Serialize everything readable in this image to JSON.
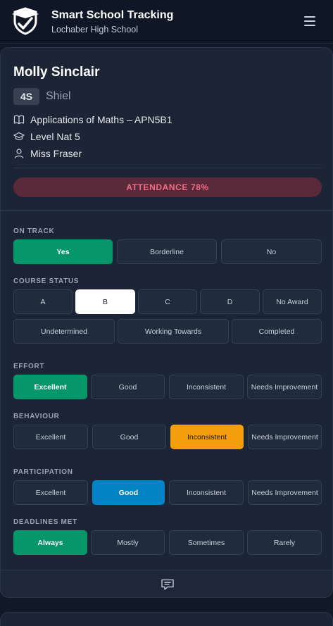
{
  "header": {
    "title": "Smart School Tracking",
    "subtitle": "Lochaber High School",
    "menu_icon": "hamburger-menu-icon"
  },
  "student": {
    "name": "Molly Sinclair",
    "class": "4S",
    "house": "Shiel",
    "course": "Applications of Maths – APN5B1",
    "level": "Level Nat 5",
    "teacher": "Miss Fraser",
    "attendance": "ATTENDANCE 78%",
    "attendance_percent": 78
  },
  "sections": {
    "on_track": {
      "label": "ON TRACK",
      "options": [
        "Yes",
        "Borderline",
        "No"
      ],
      "selected": "Yes"
    },
    "course_status": {
      "label": "COURSE STATUS",
      "options": [
        "A",
        "B",
        "C",
        "D",
        "No Award",
        "Undetermined",
        "Working Towards",
        "Completed"
      ],
      "selected": "B"
    },
    "effort": {
      "label": "EFFORT",
      "options": [
        "Excellent",
        "Good",
        "Inconsistent",
        "Needs Improvement"
      ],
      "selected": "Excellent"
    },
    "behaviour": {
      "label": "BEHAVIOUR",
      "options": [
        "Excellent",
        "Good",
        "Inconsistent",
        "Needs Improvement"
      ],
      "selected": "Inconsistent"
    },
    "participation": {
      "label": "PARTICIPATION",
      "options": [
        "Excellent",
        "Good",
        "Inconsistent",
        "Needs Improvement"
      ],
      "selected": "Good"
    },
    "deadlines_met": {
      "label": "DEADLINES MET",
      "options": [
        "Always",
        "Mostly",
        "Sometimes",
        "Rarely"
      ],
      "selected": "Always"
    }
  },
  "colors": {
    "background": "#111827",
    "card": "#1b2535",
    "green": "#059669",
    "amber": "#f59e0b",
    "blue": "#0284c7",
    "attendance_bg": "#5a2a3a",
    "attendance_text": "#f06c85"
  }
}
